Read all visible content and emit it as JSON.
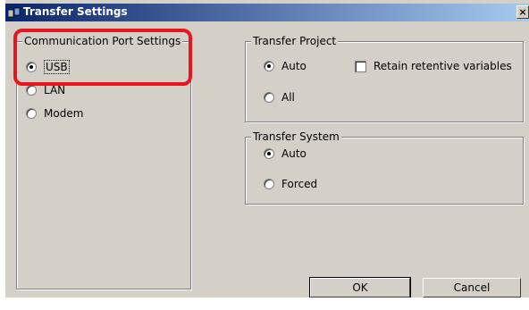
{
  "window": {
    "title": "Transfer Settings",
    "close_glyph": "×"
  },
  "comm_port": {
    "legend": "Communication Port Settings",
    "options": [
      {
        "label": "USB",
        "selected": true
      },
      {
        "label": "LAN",
        "selected": false
      },
      {
        "label": "Modem",
        "selected": false
      }
    ]
  },
  "transfer_project": {
    "legend": "Transfer Project",
    "options": [
      {
        "label": "Auto",
        "selected": true
      },
      {
        "label": "All",
        "selected": false
      }
    ],
    "retain_label": "Retain retentive variables",
    "retain_checked": false
  },
  "transfer_system": {
    "legend": "Transfer System",
    "options": [
      {
        "label": "Auto",
        "selected": true
      },
      {
        "label": "Forced",
        "selected": false
      }
    ]
  },
  "buttons": {
    "ok": "OK",
    "cancel": "Cancel"
  },
  "colors": {
    "highlight": "#e8141e",
    "title_start": "#0a246a",
    "dialog_bg": "#d4d0c8"
  }
}
